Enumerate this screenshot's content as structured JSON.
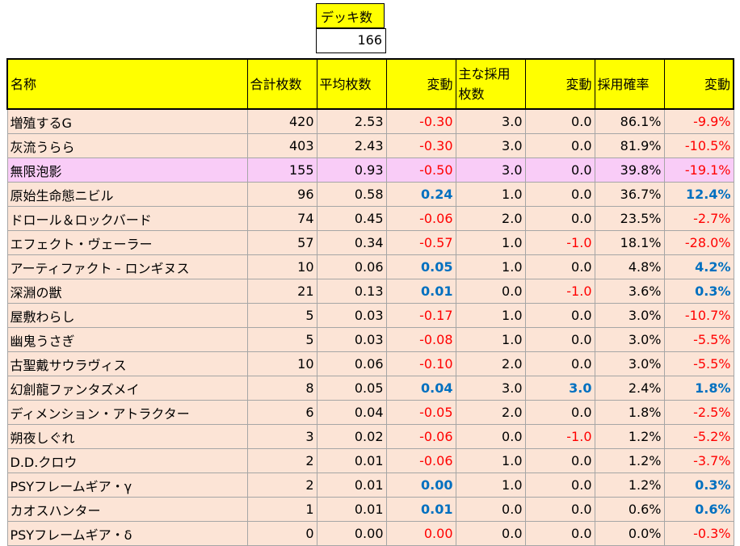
{
  "deck": {
    "label": "デッキ数",
    "value": "166"
  },
  "headers": {
    "name": "名称",
    "total": "合計枚数",
    "avg": "平均枚数",
    "change": "変動",
    "main1": "主な採用",
    "main2": "枚数",
    "rate": "採用確率"
  },
  "colors": {
    "header_bg": "#ffff00",
    "row_bg": "#fce4d6",
    "highlight_bg": "#f9ccf7",
    "negative": "#ff0000",
    "positive": "#0070c0"
  },
  "rows": [
    {
      "name": "増殖するG",
      "total": "420",
      "avg": "2.53",
      "avg_change": "-0.30",
      "main": "3.0",
      "main_change": "0.0",
      "rate": "86.1%",
      "rate_change": "-9.9%"
    },
    {
      "name": "灰流うらら",
      "total": "403",
      "avg": "2.43",
      "avg_change": "-0.30",
      "main": "3.0",
      "main_change": "0.0",
      "rate": "81.9%",
      "rate_change": "-10.5%"
    },
    {
      "name": "無限泡影",
      "total": "155",
      "avg": "0.93",
      "avg_change": "-0.50",
      "main": "3.0",
      "main_change": "0.0",
      "rate": "39.8%",
      "rate_change": "-19.1%",
      "highlight": true
    },
    {
      "name": "原始生命態ニビル",
      "total": "96",
      "avg": "0.58",
      "avg_change": "0.24",
      "main": "1.0",
      "main_change": "0.0",
      "rate": "36.7%",
      "rate_change": "12.4%"
    },
    {
      "name": "ドロール＆ロックバード",
      "total": "74",
      "avg": "0.45",
      "avg_change": "-0.06",
      "main": "2.0",
      "main_change": "0.0",
      "rate": "23.5%",
      "rate_change": "-2.7%"
    },
    {
      "name": "エフェクト・ヴェーラー",
      "total": "57",
      "avg": "0.34",
      "avg_change": "-0.57",
      "main": "1.0",
      "main_change": "-1.0",
      "rate": "18.1%",
      "rate_change": "-28.0%"
    },
    {
      "name": "アーティファクト - ロンギヌス",
      "total": "10",
      "avg": "0.06",
      "avg_change": "0.05",
      "main": "1.0",
      "main_change": "0.0",
      "rate": "4.8%",
      "rate_change": "4.2%"
    },
    {
      "name": "深淵の獣",
      "total": "21",
      "avg": "0.13",
      "avg_change": "0.01",
      "main": "0.0",
      "main_change": "-1.0",
      "rate": "3.6%",
      "rate_change": "0.3%"
    },
    {
      "name": "屋敷わらし",
      "total": "5",
      "avg": "0.03",
      "avg_change": "-0.17",
      "main": "1.0",
      "main_change": "0.0",
      "rate": "3.0%",
      "rate_change": "-10.7%"
    },
    {
      "name": "幽鬼うさぎ",
      "total": "5",
      "avg": "0.03",
      "avg_change": "-0.08",
      "main": "1.0",
      "main_change": "0.0",
      "rate": "3.0%",
      "rate_change": "-5.5%"
    },
    {
      "name": "古聖戴サウラヴィス",
      "total": "10",
      "avg": "0.06",
      "avg_change": "-0.10",
      "main": "2.0",
      "main_change": "0.0",
      "rate": "3.0%",
      "rate_change": "-5.5%"
    },
    {
      "name": "幻創龍ファンタズメイ",
      "total": "8",
      "avg": "0.05",
      "avg_change": "0.04",
      "main": "3.0",
      "main_change": "3.0",
      "rate": "2.4%",
      "rate_change": "1.8%"
    },
    {
      "name": "ディメンション・アトラクター",
      "total": "6",
      "avg": "0.04",
      "avg_change": "-0.05",
      "main": "2.0",
      "main_change": "0.0",
      "rate": "1.8%",
      "rate_change": "-2.5%"
    },
    {
      "name": "朔夜しぐれ",
      "total": "3",
      "avg": "0.02",
      "avg_change": "-0.06",
      "main": "0.0",
      "main_change": "-1.0",
      "rate": "1.2%",
      "rate_change": "-5.2%"
    },
    {
      "name": "D.D.クロウ",
      "total": "2",
      "avg": "0.01",
      "avg_change": "-0.06",
      "main": "1.0",
      "main_change": "0.0",
      "rate": "1.2%",
      "rate_change": "-3.7%"
    },
    {
      "name": "PSYフレームギア・γ",
      "total": "2",
      "avg": "0.01",
      "avg_change": "0.00",
      "main": "1.0",
      "main_change": "0.0",
      "rate": "1.2%",
      "rate_change": "0.3%"
    },
    {
      "name": "カオスハンター",
      "total": "1",
      "avg": "0.01",
      "avg_change": "0.01",
      "main": "0.0",
      "main_change": "0.0",
      "rate": "0.6%",
      "rate_change": "0.6%"
    },
    {
      "name": "PSYフレームギア・δ",
      "total": "0",
      "avg": "0.00",
      "avg_change": "0.00",
      "main": "0.0",
      "main_change": "0.0",
      "rate": "0.0%",
      "rate_change": "-0.3%",
      "avg_change_red": true
    }
  ]
}
